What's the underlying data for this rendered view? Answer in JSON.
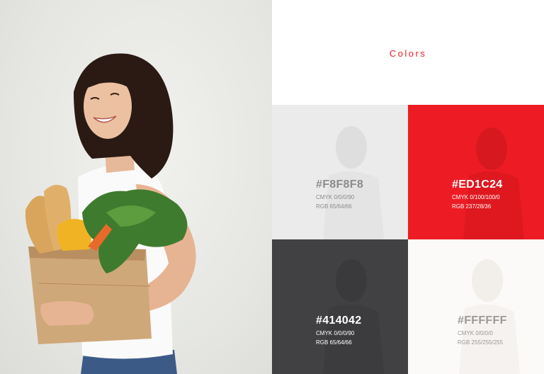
{
  "title": "Colors",
  "photo": {
    "description_icon": "woman-with-grocery-bag-image"
  },
  "swatches": [
    {
      "hex": "#F8F8F8",
      "cmyk": "CMYK 0/0/0/90",
      "rgb": "RGB 65/64/66",
      "bg": "#ebebeb",
      "text": "#8c8c8c"
    },
    {
      "hex": "#ED1C24",
      "cmyk": "CMYK 0/100/100/0",
      "rgb": "RGB 237/28/36",
      "bg": "#ED1C24",
      "text": "#ffffff"
    },
    {
      "hex": "#414042",
      "cmyk": "CMYK 0/0/0/90",
      "rgb": "RGB 65/64/66",
      "bg": "#414042",
      "text": "#ffffff"
    },
    {
      "hex": "#FFFFFF",
      "cmyk": "CMYK 0/0/0/0",
      "rgb": "RGB 255/255/255",
      "bg": "#fbfaf8",
      "text": "#9a9a9a"
    }
  ]
}
